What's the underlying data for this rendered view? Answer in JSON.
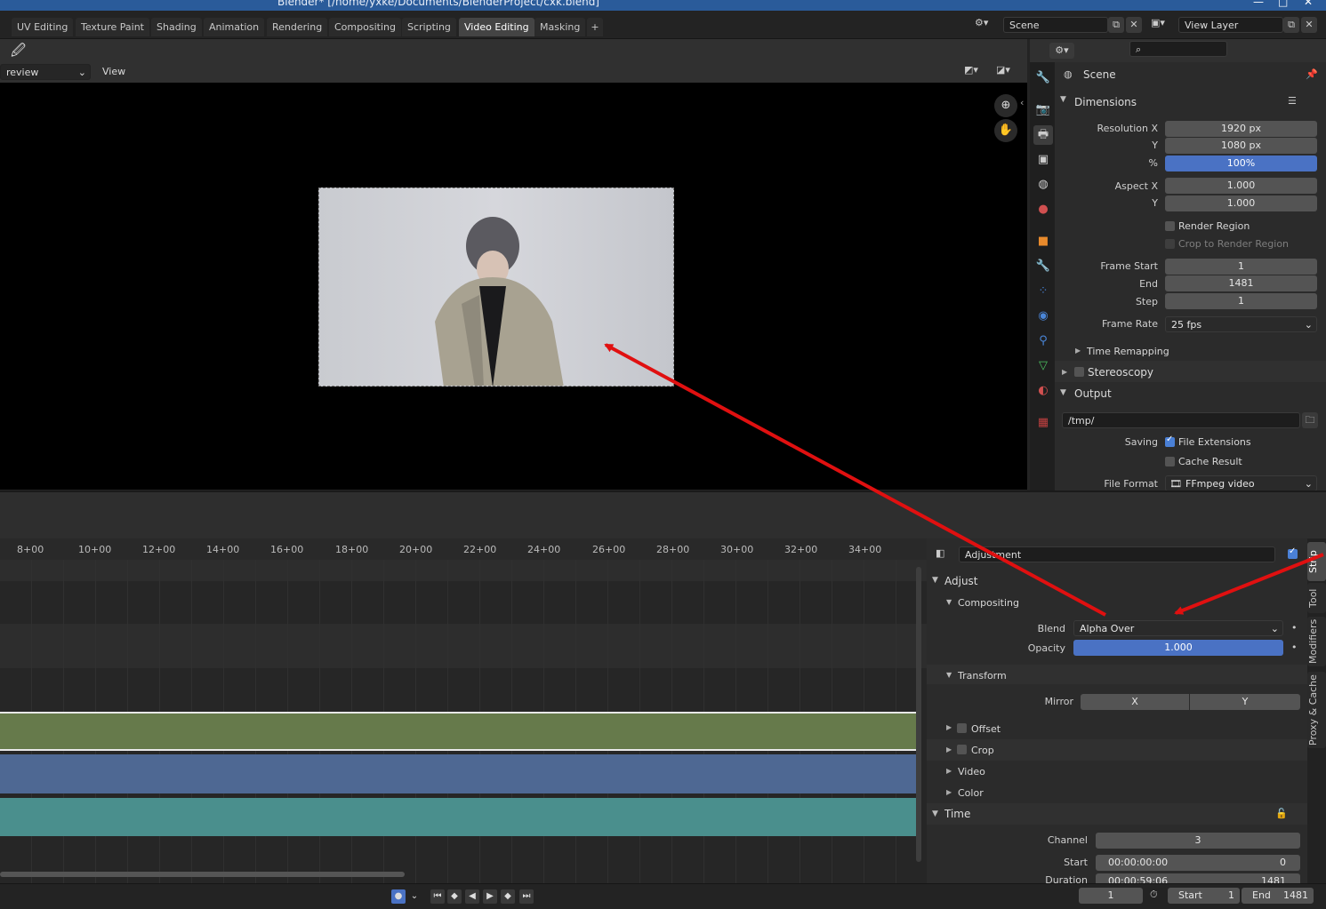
{
  "window": {
    "title": "Blender* [/home/yxke/Documents/BlenderProject/cxk.blend]"
  },
  "workspace_tabs": [
    "UV Editing",
    "Texture Paint",
    "Shading",
    "Animation",
    "Rendering",
    "Compositing",
    "Scripting",
    "Video Editing",
    "Masking"
  ],
  "active_workspace": "Video Editing",
  "top_right": {
    "scene_label": "Scene",
    "view_layer_label": "View Layer"
  },
  "preview_header": {
    "mode_value": "review",
    "view_menu": "View"
  },
  "properties": {
    "context": "Scene",
    "dimensions": {
      "title": "Dimensions",
      "resolution_x_label": "Resolution X",
      "resolution_x": "1920 px",
      "resolution_y_label": "Y",
      "resolution_y": "1080 px",
      "percent_label": "%",
      "percent": "100%",
      "aspect_x_label": "Aspect X",
      "aspect_x": "1.000",
      "aspect_y_label": "Y",
      "aspect_y": "1.000",
      "render_region": "Render Region",
      "crop_region": "Crop to Render Region",
      "frame_start_label": "Frame Start",
      "frame_start": "1",
      "end_label": "End",
      "end": "1481",
      "step_label": "Step",
      "step": "1",
      "frame_rate_label": "Frame Rate",
      "frame_rate": "25 fps",
      "time_remapping": "Time Remapping"
    },
    "stereoscopy": "Stereoscopy",
    "output": {
      "title": "Output",
      "path": "/tmp/",
      "saving_label": "Saving",
      "file_extensions": "File Extensions",
      "cache_result": "Cache Result",
      "file_format_label": "File Format",
      "file_format": "FFmpeg video"
    }
  },
  "ruler": [
    "8+00",
    "10+00",
    "12+00",
    "14+00",
    "16+00",
    "18+00",
    "20+00",
    "22+00",
    "24+00",
    "26+00",
    "28+00",
    "30+00",
    "32+00",
    "34+00"
  ],
  "strip_sidebar": {
    "strip_name": "Adjustment",
    "adjust": "Adjust",
    "compositing": "Compositing",
    "blend_label": "Blend",
    "blend_value": "Alpha Over",
    "opacity_label": "Opacity",
    "opacity_value": "1.000",
    "transform": "Transform",
    "mirror_label": "Mirror",
    "mirror_x": "X",
    "mirror_y": "Y",
    "offset": "Offset",
    "crop": "Crop",
    "video": "Video",
    "color": "Color",
    "time": "Time",
    "channel_label": "Channel",
    "channel_value": "3",
    "start_label": "Start",
    "start_time": "00:00:00:00",
    "start_frame": "0",
    "duration_label": "Duration",
    "duration_time": "00:00:59:06",
    "duration_frame": "1481"
  },
  "side_tabs": [
    "Strip",
    "Tool",
    "Modifiers",
    "Proxy & Cache"
  ],
  "statusbar": {
    "current_frame": "1",
    "start_label": "Start",
    "start": "1",
    "end_label": "End",
    "end": "1481"
  },
  "colors": {
    "strip_adjustment": "#667a4b",
    "strip_blue": "#4e6893",
    "strip_teal": "#4a8f8d",
    "accent": "#4a72c4",
    "annotation_arrow": "#e01010"
  }
}
